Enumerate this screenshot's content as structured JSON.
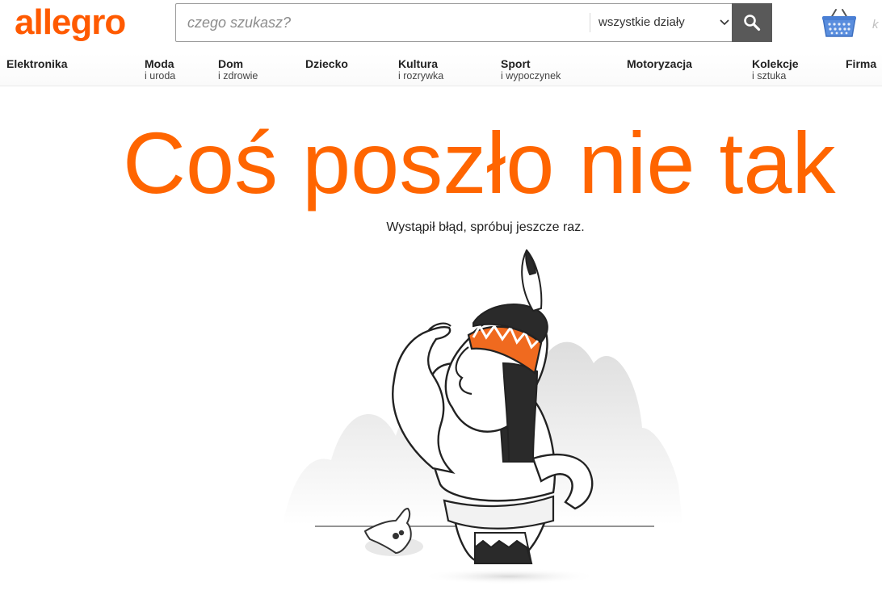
{
  "header": {
    "logo_text": "allegro",
    "search": {
      "placeholder": "czego szukasz?",
      "value": ""
    },
    "category_select": {
      "selected": "wszystkie działy"
    },
    "cut_text": "k",
    "icons": {
      "search_button": "search-icon",
      "chevron": "chevron-down-icon",
      "basket": "basket-icon"
    }
  },
  "nav": {
    "items": [
      {
        "label": "Elektronika",
        "sub": ""
      },
      {
        "label": "Moda",
        "sub": "i uroda"
      },
      {
        "label": "Dom",
        "sub": "i zdrowie"
      },
      {
        "label": "Dziecko",
        "sub": ""
      },
      {
        "label": "Kultura",
        "sub": "i rozrywka"
      },
      {
        "label": "Sport",
        "sub": "i wypoczynek"
      },
      {
        "label": "Motoryzacja",
        "sub": ""
      },
      {
        "label": "Kolekcje",
        "sub": "i sztuka"
      },
      {
        "label": "Firma",
        "sub": ""
      }
    ]
  },
  "content": {
    "title": "Coś poszło nie tak",
    "message": "Wystąpił błąd, spróbuj jeszcze raz."
  },
  "colors": {
    "brand": "#ff5a00",
    "title": "#ff6500",
    "search_button": "#595959",
    "basket": "#5a8ede"
  }
}
